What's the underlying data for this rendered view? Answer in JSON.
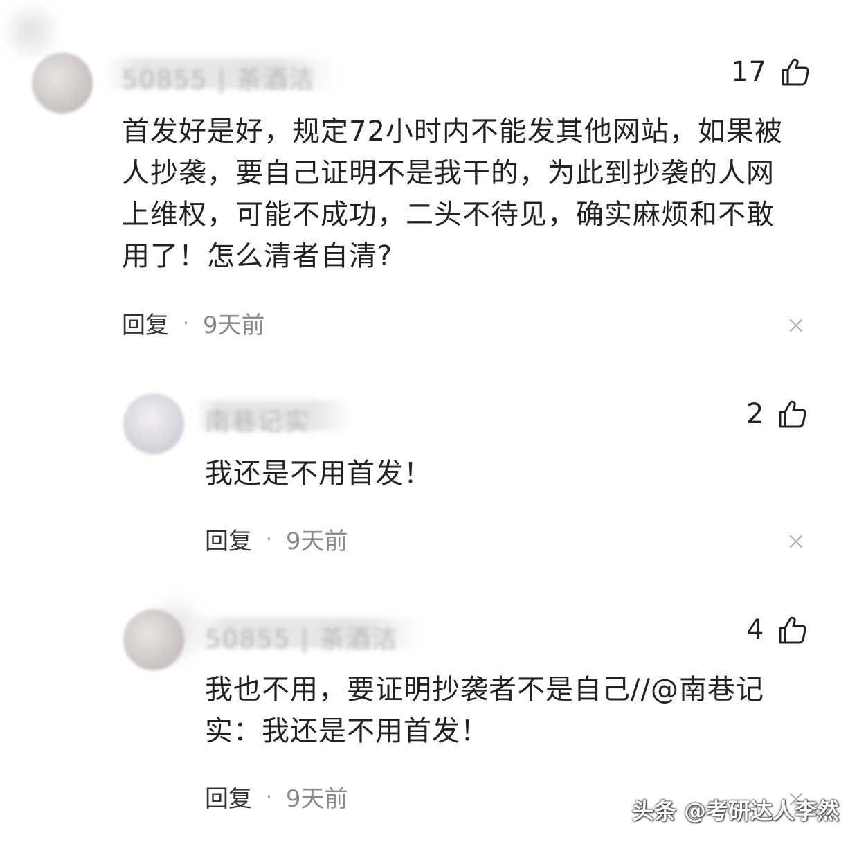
{
  "comments": [
    {
      "username": "50855 | 茶酒洁",
      "likes": "17",
      "text_lines": [
        "首发好是好，规定72小时内不能发其他网站，如果被",
        "人抄袭，要自己证明不是我干的，为此到抄袭的人网",
        "上维权，可能不成功，二头不待见，确实麻烦和不敢",
        "用了！怎么清者自清?"
      ],
      "reply_label": "回复",
      "separator": "·",
      "time": "9天前"
    },
    {
      "username": "南巷记实",
      "likes": "2",
      "text_lines": [
        "我还是不用首发！"
      ],
      "reply_label": "回复",
      "separator": "·",
      "time": "9天前"
    },
    {
      "username": "50855 | 茶酒洁",
      "likes": "4",
      "text_lines": [
        "我也不用，要证明抄袭者不是自己//@南巷记",
        "实：我还是不用首发！"
      ],
      "reply_label": "回复",
      "separator": "·",
      "time": "9天前"
    }
  ],
  "watermark": "头条 @考研达人李然",
  "icons": {
    "like": "thumbs-up-icon",
    "close": "close-icon"
  }
}
